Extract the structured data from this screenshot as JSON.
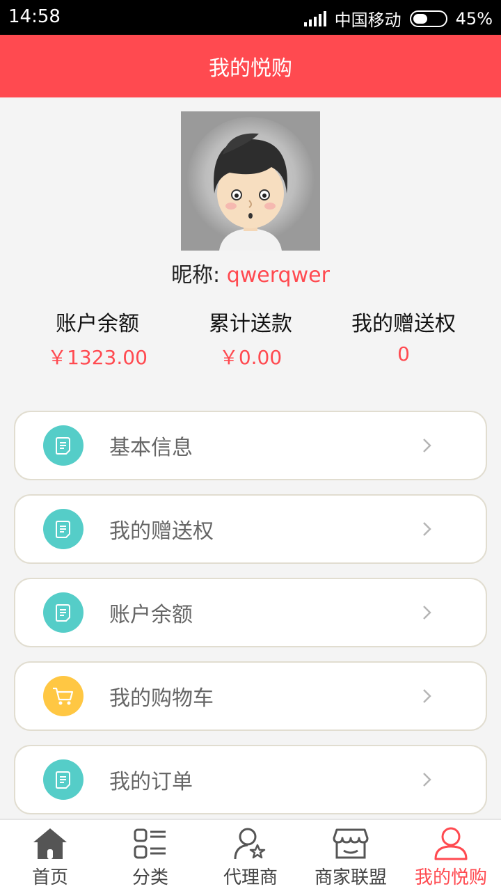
{
  "status": {
    "time": "14:58",
    "carrier": "中国移动",
    "battery": "45%",
    "battery_level": 0.45
  },
  "header": {
    "title": "我的悦购"
  },
  "profile": {
    "nickname_label": "昵称:",
    "nickname": "qwerqwer"
  },
  "stats": [
    {
      "label": "账户余额",
      "value": "￥1323.00"
    },
    {
      "label": "累计送款",
      "value": "￥0.00"
    },
    {
      "label": "我的赠送权",
      "value": "0"
    }
  ],
  "menu": [
    {
      "label": "基本信息",
      "icon": "document-icon",
      "color": "#55cdc8"
    },
    {
      "label": "我的赠送权",
      "icon": "document-icon",
      "color": "#55cdc8"
    },
    {
      "label": "账户余额",
      "icon": "document-icon",
      "color": "#55cdc8"
    },
    {
      "label": "我的购物车",
      "icon": "cart-icon",
      "color": "#ffc743"
    },
    {
      "label": "我的订单",
      "icon": "document-icon",
      "color": "#55cdc8"
    }
  ],
  "tabs": [
    {
      "label": "首页",
      "icon": "home-icon"
    },
    {
      "label": "分类",
      "icon": "category-icon"
    },
    {
      "label": "代理商",
      "icon": "agent-icon"
    },
    {
      "label": "商家联盟",
      "icon": "store-icon"
    },
    {
      "label": "我的悦购",
      "icon": "user-icon",
      "active": true
    }
  ],
  "colors": {
    "accent": "#ff4a50",
    "teal": "#55cdc8",
    "yellow": "#ffc743"
  }
}
